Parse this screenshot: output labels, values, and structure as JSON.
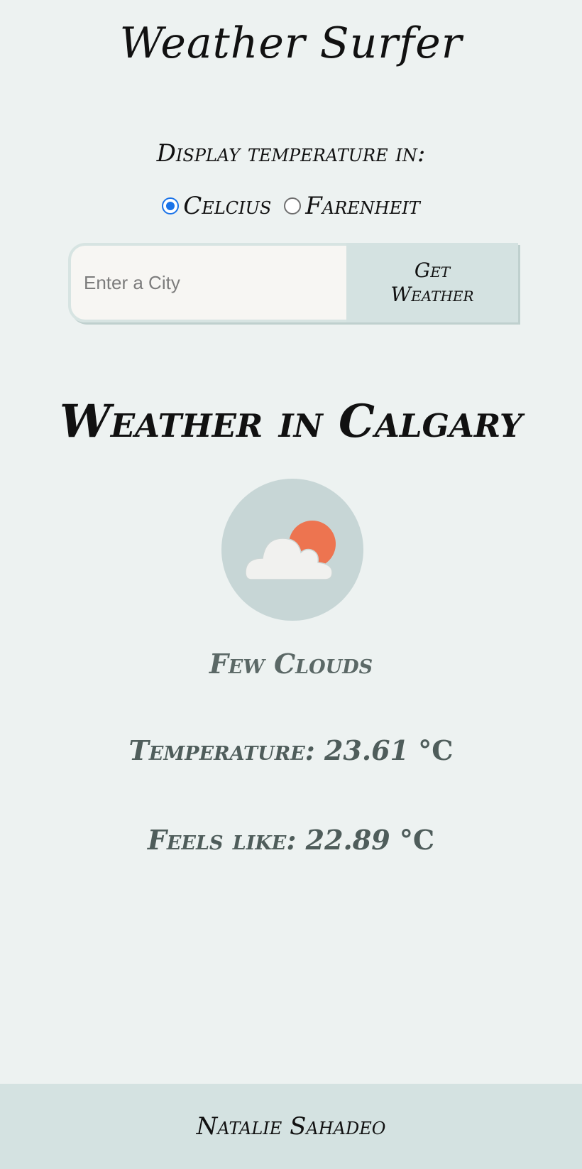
{
  "app_title": "Weather Surfer",
  "unit_prompt": "Display temperature in:",
  "units": [
    {
      "label": "Celcius",
      "checked": true
    },
    {
      "label": "Farenheit",
      "checked": false
    }
  ],
  "search": {
    "placeholder": "Enter a City",
    "button_line1": "Get",
    "button_line2": "Weather"
  },
  "weather": {
    "heading": "Weather in Calgary",
    "icon": "few-clouds-icon",
    "description": "Few Clouds",
    "temperature_label": "Temperature:",
    "temperature_value": "23.61",
    "feels_like_label": "Feels like:",
    "feels_like_value": "22.89",
    "unit_symbol": "°C"
  },
  "colors": {
    "page_bg": "#edf2f1",
    "accent_panel": "#d4e2e1",
    "sun": "#ed7450",
    "radio_selected": "#1a73e8"
  },
  "footer": {
    "author": "Natalie Sahadeo"
  }
}
